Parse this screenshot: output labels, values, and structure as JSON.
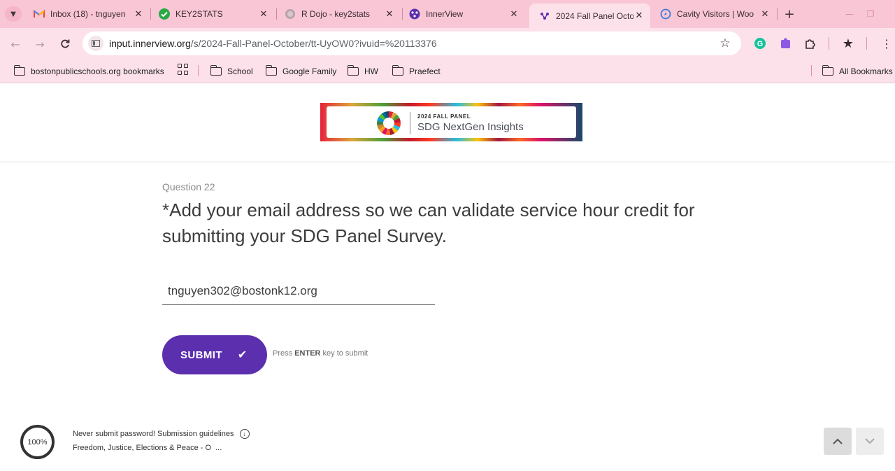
{
  "browser": {
    "tabs": [
      {
        "title": "Inbox (18) - tnguyen",
        "icon": "gmail-icon"
      },
      {
        "title": "KEY2STATS",
        "icon": "check-circle-icon"
      },
      {
        "title": "R Dojo - key2stats",
        "icon": "globe-icon"
      },
      {
        "title": "InnerView",
        "icon": "innerview-icon"
      },
      {
        "title": "2024 Fall Panel Octo",
        "icon": "innerview-icon",
        "active": true
      },
      {
        "title": "Cavity Visitors | Woo",
        "icon": "compass-icon"
      }
    ],
    "url_host": "input.innerview.org",
    "url_path": "/s/2024-Fall-Panel-October/tt-UyOW0?ivuid=%20113376",
    "bookmarks": [
      {
        "label": "bostonpublicschools.org bookmarks"
      },
      {
        "label": "School"
      },
      {
        "label": "Google Family"
      },
      {
        "label": "HW"
      },
      {
        "label": "Praefect"
      }
    ],
    "all_bookmarks": "All Bookmarks",
    "theme_color": "#f9c6d6"
  },
  "header": {
    "banner_kicker": "2024 FALL PANEL",
    "banner_title": "SDG NextGen Insights"
  },
  "question": {
    "number_label": "Question 22",
    "text": "*Add your email address so we can validate service hour credit for submitting your SDG Panel Survey.",
    "answer_value": "tnguyen302@bostonk12.org"
  },
  "submit": {
    "label": "SUBMIT",
    "hint_prefix": "Press",
    "hint_key": "ENTER",
    "hint_suffix": "key to submit",
    "color": "#5b2fae"
  },
  "footer": {
    "progress_label": "100%",
    "progress_value": 1.0,
    "line1": "Never submit password! Submission guidelines",
    "line2": "Freedom, Justice, Elections & Peace - O",
    "ellipsis": "..."
  }
}
